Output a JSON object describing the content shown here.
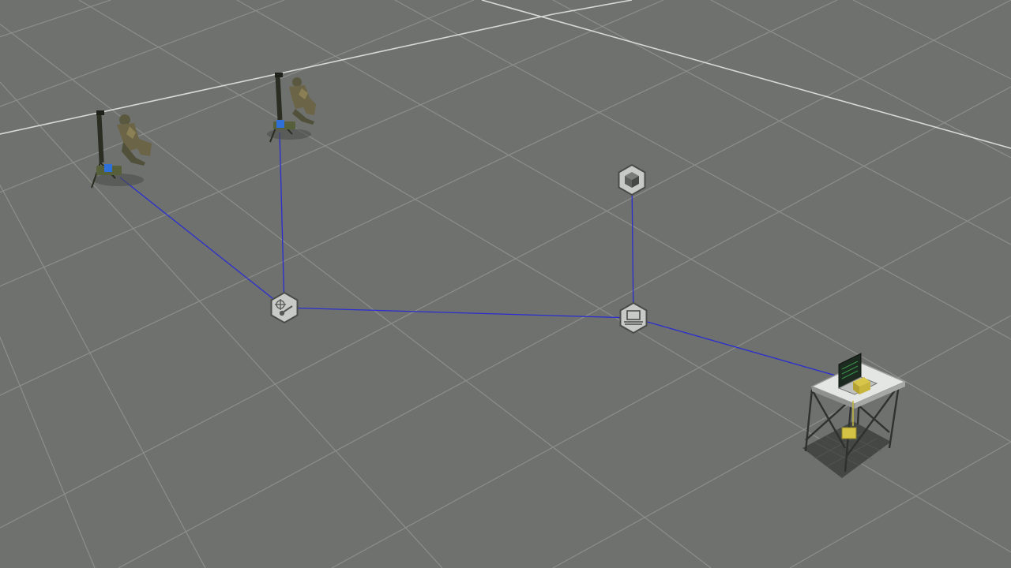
{
  "scene": {
    "background_color": "#6f716e",
    "grid_color": "#8c8e8b",
    "grid_major_color": "#d9dbd8",
    "link_color": "#2a2ecf",
    "node_fill": "#c8cac7",
    "node_stroke": "#4a4c49"
  },
  "nodes": [
    {
      "name": "mortar-team-1",
      "kind": "soldier-mortar"
    },
    {
      "name": "mortar-team-2",
      "kind": "soldier-mortar"
    },
    {
      "name": "fire-support-module",
      "kind": "module-icon",
      "icon": "crosshair-icon"
    },
    {
      "name": "object-module",
      "kind": "module-icon",
      "icon": "cube-icon"
    },
    {
      "name": "laptop-module",
      "kind": "module-icon",
      "icon": "laptop-icon"
    },
    {
      "name": "field-table",
      "kind": "table-with-laptop"
    }
  ],
  "links": [
    {
      "from": "mortar-team-1",
      "to": "fire-support-module"
    },
    {
      "from": "mortar-team-2",
      "to": "fire-support-module"
    },
    {
      "from": "fire-support-module",
      "to": "laptop-module"
    },
    {
      "from": "object-module",
      "to": "laptop-module"
    },
    {
      "from": "laptop-module",
      "to": "field-table"
    }
  ]
}
